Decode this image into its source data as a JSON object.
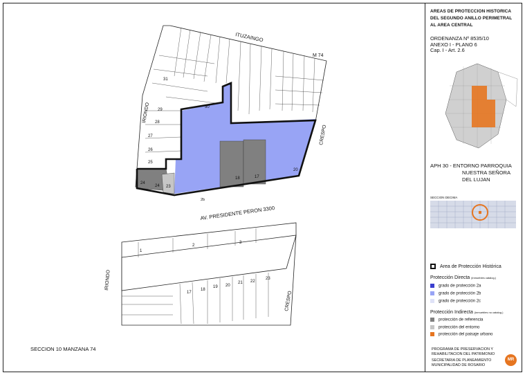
{
  "title": {
    "line1": "AREAS DE PROTECCION HISTORICA",
    "line2": "DEL SEGUNDO ANILLO PERIMETRAL",
    "line3": "AL AREA CENTRAL"
  },
  "ordinance": {
    "line1": "ORDENANZA Nº 8535/10",
    "line2": "ANEXO I - PLANO 6",
    "line3": "Cap. I - Art. 2.6"
  },
  "aph": {
    "line1": "APH 30 - ENTORNO PARROQUIA",
    "line2": "NUESTRA SEÑORA",
    "line3": "DEL LUJAN"
  },
  "section_map_label": "SECCION DECIMA",
  "legend": {
    "area_label": "Area de Protección Histórica",
    "directa_title": "Protección Directa",
    "directa_note": "(inmuebles catalog.)",
    "grado_2a": "grado de protección 2a",
    "grado_2b": "grado de protección 2b",
    "grado_2c": "grado de protección 2c",
    "indirecta_title": "Protección Indirecta",
    "indirecta_note": "(inmuebles no catalog.)",
    "referencia": "protección de referencia",
    "entorno": "protección del entorno",
    "paisaje": "protección del paisaje urbano"
  },
  "colors": {
    "grado_2a": "#3b3fcf",
    "grado_2b": "#98a4f5",
    "grado_2c": "#dfe2f7",
    "referencia": "#808080",
    "entorno": "#c6c6c6",
    "paisaje": "#e67520"
  },
  "footer": {
    "section": "SECCION 10  MANZANA 74",
    "program1": "PROGRAMA DE PRESERVACION Y",
    "program2": "REHABILITACION DEL PATRIMONIO",
    "secretaria1": "SECRETARIA DE PLANEAMIENTO",
    "secretaria2": "MUNICIPALIDAD DE ROSARIO",
    "logo": "MR"
  },
  "map": {
    "street_top": "ITUZAINGO",
    "street_left": "IRIONDO",
    "street_right": "CRESPO",
    "street_bottom": "AV. PRESIDENTE PERON 3300",
    "street_left2": "IRIONDO",
    "street_right2": "CRESPO",
    "manzana": "M 74",
    "lot_20": "20",
    "lot_18": "18",
    "lot_17": "17",
    "lot_24": "24",
    "lot_24b": "24",
    "lot_23": "23",
    "lot_25": "25",
    "lot_26": "26",
    "lot_27": "27",
    "lot_28": "28",
    "lot_29": "29",
    "lot_30": "30",
    "lot_31": "31",
    "lot_2b": "2b",
    "lot_b2": "2",
    "lot_b3": "3",
    "lot_b1": "1",
    "lot_b17": "17",
    "lot_b18": "18",
    "lot_b19": "19",
    "lot_b20": "20",
    "lot_b21": "21",
    "lot_b22": "22",
    "lot_b23": "23"
  }
}
